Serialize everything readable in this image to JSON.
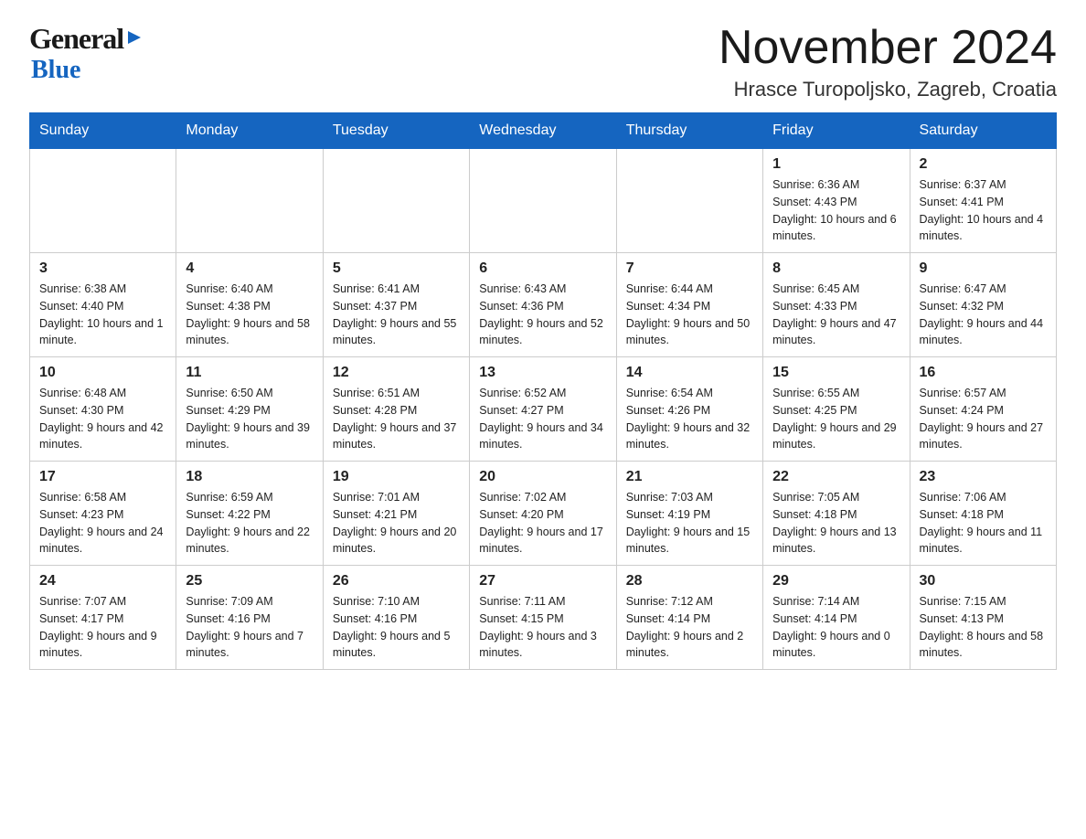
{
  "header": {
    "logo_general": "General",
    "logo_blue": "Blue",
    "month_title": "November 2024",
    "location": "Hrasce Turopoljsko, Zagreb, Croatia"
  },
  "days_of_week": [
    "Sunday",
    "Monday",
    "Tuesday",
    "Wednesday",
    "Thursday",
    "Friday",
    "Saturday"
  ],
  "weeks": [
    [
      {
        "day": "",
        "info": ""
      },
      {
        "day": "",
        "info": ""
      },
      {
        "day": "",
        "info": ""
      },
      {
        "day": "",
        "info": ""
      },
      {
        "day": "",
        "info": ""
      },
      {
        "day": "1",
        "info": "Sunrise: 6:36 AM\nSunset: 4:43 PM\nDaylight: 10 hours and 6 minutes."
      },
      {
        "day": "2",
        "info": "Sunrise: 6:37 AM\nSunset: 4:41 PM\nDaylight: 10 hours and 4 minutes."
      }
    ],
    [
      {
        "day": "3",
        "info": "Sunrise: 6:38 AM\nSunset: 4:40 PM\nDaylight: 10 hours and 1 minute."
      },
      {
        "day": "4",
        "info": "Sunrise: 6:40 AM\nSunset: 4:38 PM\nDaylight: 9 hours and 58 minutes."
      },
      {
        "day": "5",
        "info": "Sunrise: 6:41 AM\nSunset: 4:37 PM\nDaylight: 9 hours and 55 minutes."
      },
      {
        "day": "6",
        "info": "Sunrise: 6:43 AM\nSunset: 4:36 PM\nDaylight: 9 hours and 52 minutes."
      },
      {
        "day": "7",
        "info": "Sunrise: 6:44 AM\nSunset: 4:34 PM\nDaylight: 9 hours and 50 minutes."
      },
      {
        "day": "8",
        "info": "Sunrise: 6:45 AM\nSunset: 4:33 PM\nDaylight: 9 hours and 47 minutes."
      },
      {
        "day": "9",
        "info": "Sunrise: 6:47 AM\nSunset: 4:32 PM\nDaylight: 9 hours and 44 minutes."
      }
    ],
    [
      {
        "day": "10",
        "info": "Sunrise: 6:48 AM\nSunset: 4:30 PM\nDaylight: 9 hours and 42 minutes."
      },
      {
        "day": "11",
        "info": "Sunrise: 6:50 AM\nSunset: 4:29 PM\nDaylight: 9 hours and 39 minutes."
      },
      {
        "day": "12",
        "info": "Sunrise: 6:51 AM\nSunset: 4:28 PM\nDaylight: 9 hours and 37 minutes."
      },
      {
        "day": "13",
        "info": "Sunrise: 6:52 AM\nSunset: 4:27 PM\nDaylight: 9 hours and 34 minutes."
      },
      {
        "day": "14",
        "info": "Sunrise: 6:54 AM\nSunset: 4:26 PM\nDaylight: 9 hours and 32 minutes."
      },
      {
        "day": "15",
        "info": "Sunrise: 6:55 AM\nSunset: 4:25 PM\nDaylight: 9 hours and 29 minutes."
      },
      {
        "day": "16",
        "info": "Sunrise: 6:57 AM\nSunset: 4:24 PM\nDaylight: 9 hours and 27 minutes."
      }
    ],
    [
      {
        "day": "17",
        "info": "Sunrise: 6:58 AM\nSunset: 4:23 PM\nDaylight: 9 hours and 24 minutes."
      },
      {
        "day": "18",
        "info": "Sunrise: 6:59 AM\nSunset: 4:22 PM\nDaylight: 9 hours and 22 minutes."
      },
      {
        "day": "19",
        "info": "Sunrise: 7:01 AM\nSunset: 4:21 PM\nDaylight: 9 hours and 20 minutes."
      },
      {
        "day": "20",
        "info": "Sunrise: 7:02 AM\nSunset: 4:20 PM\nDaylight: 9 hours and 17 minutes."
      },
      {
        "day": "21",
        "info": "Sunrise: 7:03 AM\nSunset: 4:19 PM\nDaylight: 9 hours and 15 minutes."
      },
      {
        "day": "22",
        "info": "Sunrise: 7:05 AM\nSunset: 4:18 PM\nDaylight: 9 hours and 13 minutes."
      },
      {
        "day": "23",
        "info": "Sunrise: 7:06 AM\nSunset: 4:18 PM\nDaylight: 9 hours and 11 minutes."
      }
    ],
    [
      {
        "day": "24",
        "info": "Sunrise: 7:07 AM\nSunset: 4:17 PM\nDaylight: 9 hours and 9 minutes."
      },
      {
        "day": "25",
        "info": "Sunrise: 7:09 AM\nSunset: 4:16 PM\nDaylight: 9 hours and 7 minutes."
      },
      {
        "day": "26",
        "info": "Sunrise: 7:10 AM\nSunset: 4:16 PM\nDaylight: 9 hours and 5 minutes."
      },
      {
        "day": "27",
        "info": "Sunrise: 7:11 AM\nSunset: 4:15 PM\nDaylight: 9 hours and 3 minutes."
      },
      {
        "day": "28",
        "info": "Sunrise: 7:12 AM\nSunset: 4:14 PM\nDaylight: 9 hours and 2 minutes."
      },
      {
        "day": "29",
        "info": "Sunrise: 7:14 AM\nSunset: 4:14 PM\nDaylight: 9 hours and 0 minutes."
      },
      {
        "day": "30",
        "info": "Sunrise: 7:15 AM\nSunset: 4:13 PM\nDaylight: 8 hours and 58 minutes."
      }
    ]
  ]
}
